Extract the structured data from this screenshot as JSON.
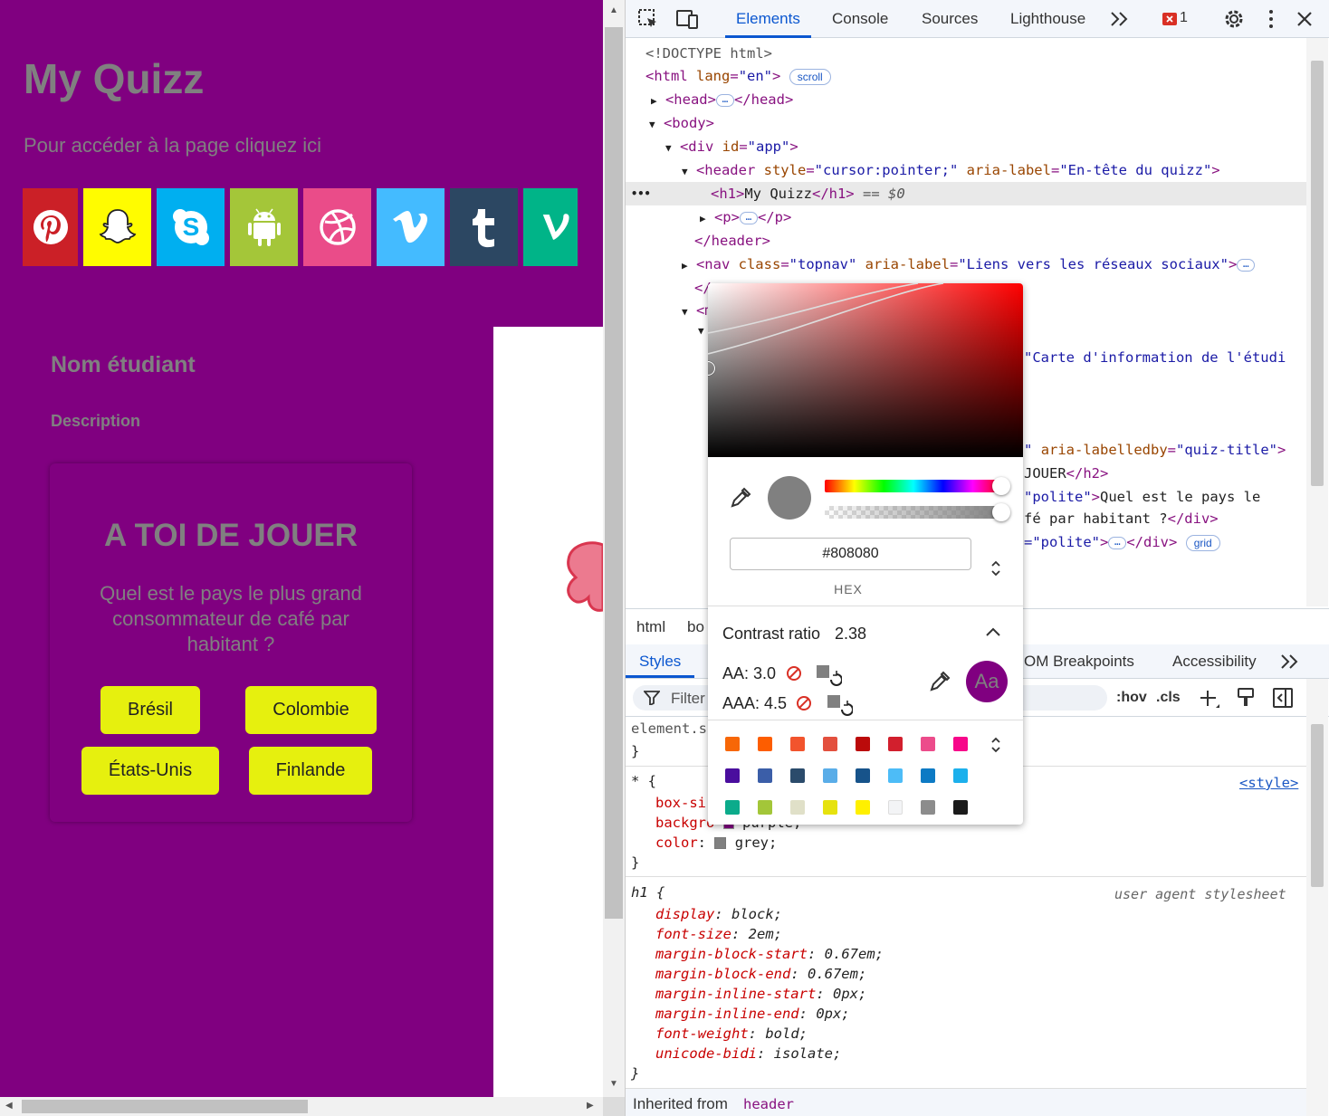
{
  "page": {
    "title": "My Quizz",
    "subtitle": "Pour accéder à la page cliquez ici",
    "social_icons": [
      "pinterest-icon",
      "snapchat-icon",
      "skype-icon",
      "android-icon",
      "dribbble-icon",
      "vimeo-icon",
      "tumblr-icon",
      "vine-icon"
    ],
    "student_name": "Nom étudiant",
    "description": "Description",
    "quiz": {
      "title": "A TOI DE JOUER",
      "question": "Quel est le pays le plus grand consommateur de café par habitant ?",
      "answers": [
        "Brésil",
        "Colombie",
        "États-Unis",
        "Finlande"
      ]
    },
    "colors": {
      "background": "#800080",
      "text": "#808080",
      "button": "#e6f00e"
    }
  },
  "devtools": {
    "tabs": [
      "Elements",
      "Console",
      "Sources",
      "Lighthouse"
    ],
    "active_tab": "Elements",
    "error_count": "1",
    "dom": {
      "doctype": "<!DOCTYPE html>",
      "html_tag": "<html",
      "html_lang_attr": "lang",
      "html_lang_val": "\"en\"",
      "scroll_badge": "scroll",
      "head": "<head>",
      "head_close": "</head>",
      "body": "<body>",
      "div_app_open": "<div",
      "div_id_attr": "id",
      "div_id_val": "\"app\"",
      "header_open": "<header",
      "header_style_attr": "style",
      "header_style_val": "\"cursor:pointer;\"",
      "header_aria_attr": "aria-label",
      "header_aria_val": "\"En-tête du quizz\"",
      "h1_open": "<h1>",
      "h1_text": "My Quizz",
      "h1_close": "</h1>",
      "h1_sel": " == $0",
      "p_open": "<p>",
      "p_close": "</p>",
      "header_close": "</header>",
      "nav_open": "<nav",
      "nav_class_attr": "class",
      "nav_class_val": "\"topnav\"",
      "nav_aria_attr": "aria-label",
      "nav_aria_val": "\"Liens vers les réseaux sociaux\"",
      "frag_slash": "</",
      "frag_m": "<m",
      "frag_card": "\"Carte d'information de l'étudi",
      "frag_labelledby": "\"",
      "frag_labelledby_attr": "aria-labelledby",
      "frag_labelledby_val": "\"quiz-title\"",
      "frag_jouer": "JOUER",
      "frag_h2close": "</h2>",
      "frag_polite1": "\"polite\"",
      "frag_question1": "Quel est le pays le",
      "frag_question2": "fé par habitant ?",
      "frag_divclose": "</div>",
      "frag_polite2": "=\"polite\"",
      "frag_divclose2": "</div>",
      "grid_badge": "grid"
    },
    "breadcrumbs": [
      "html",
      "bo"
    ],
    "style_tabs": [
      "Styles",
      "OM Breakpoints",
      "Accessibility"
    ],
    "filter_placeholder": "Filter",
    "hov": ":hov",
    "cls": ".cls",
    "styles": {
      "element_style": "element.s",
      "close_brace": "}",
      "universal_selector": "* {",
      "style_link": "<style>",
      "prop_box": "box-si",
      "prop_bg": "backgro",
      "bg_value": "purple;",
      "prop_color": "color",
      "color_value": "grey;",
      "h1_selector": "h1 {",
      "ua_label": "user agent stylesheet",
      "h1_rules": [
        {
          "prop": "display",
          "val": "block;"
        },
        {
          "prop": "font-size",
          "val": "2em;"
        },
        {
          "prop": "margin-block-start",
          "val": "0.67em;"
        },
        {
          "prop": "margin-block-end",
          "val": "0.67em;"
        },
        {
          "prop": "margin-inline-start",
          "val": "0px;"
        },
        {
          "prop": "margin-inline-end",
          "val": "0px;"
        },
        {
          "prop": "font-weight",
          "val": "bold;"
        },
        {
          "prop": "unicode-bidi",
          "val": "isolate;"
        }
      ],
      "inherited_label": "Inherited from",
      "inherited_from": "header"
    },
    "color_picker": {
      "hex_value": "#808080",
      "format_label": "HEX",
      "contrast_label": "Contrast ratio",
      "contrast_value": "2.38",
      "aa_label": "AA: 3.0",
      "aaa_label": "AAA: 4.5",
      "preview_text": "Aa",
      "swatches": [
        "#f76707",
        "#fd5d00",
        "#f2542d",
        "#e3503e",
        "#bb0a0a",
        "#d21f2d",
        "#ec4c8b",
        "#f7078a",
        "#4a0e9e",
        "#3b5ea8",
        "#2b4b6b",
        "#5aade8",
        "#17538a",
        "#4dbcf7",
        "#0d7ac4",
        "#1cb0ec",
        "#0cab8b",
        "#a3c639",
        "#e0e0c8",
        "#e6e20e",
        "#fff000",
        "#f3f4f6",
        "#8c8c8c",
        "#1a1a1a"
      ]
    }
  }
}
